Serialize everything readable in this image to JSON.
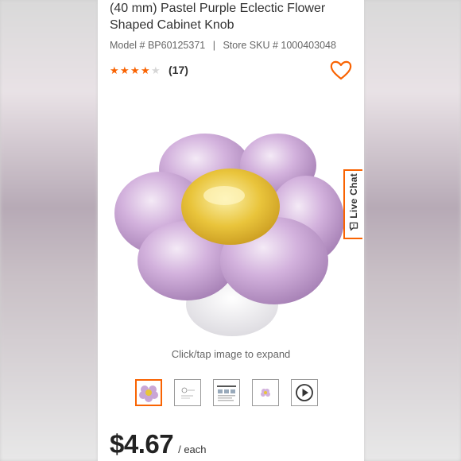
{
  "product": {
    "title_line1": "(40 mm) Pastel Purple Eclectic Flower",
    "title_line2": "Shaped Cabinet Knob",
    "model_label": "Model # BP60125371",
    "separator": "|",
    "sku_label": "Store SKU # 1000403048",
    "rating": 4,
    "rating_max": 5,
    "review_count": "(17)"
  },
  "gallery": {
    "expand_hint": "Click/tap image to expand",
    "thumbnails": [
      "flower-knob-photo",
      "product-diagram",
      "spec-sheet",
      "flower-knob-small",
      "video-play"
    ],
    "active_index": 0
  },
  "pricing": {
    "amount": "$4.67",
    "unit": "/ each"
  },
  "live_chat": {
    "label": "Live Chat"
  },
  "colors": {
    "accent": "#f96302",
    "petal": "#c9a6d6",
    "center": "#e8c63a"
  }
}
